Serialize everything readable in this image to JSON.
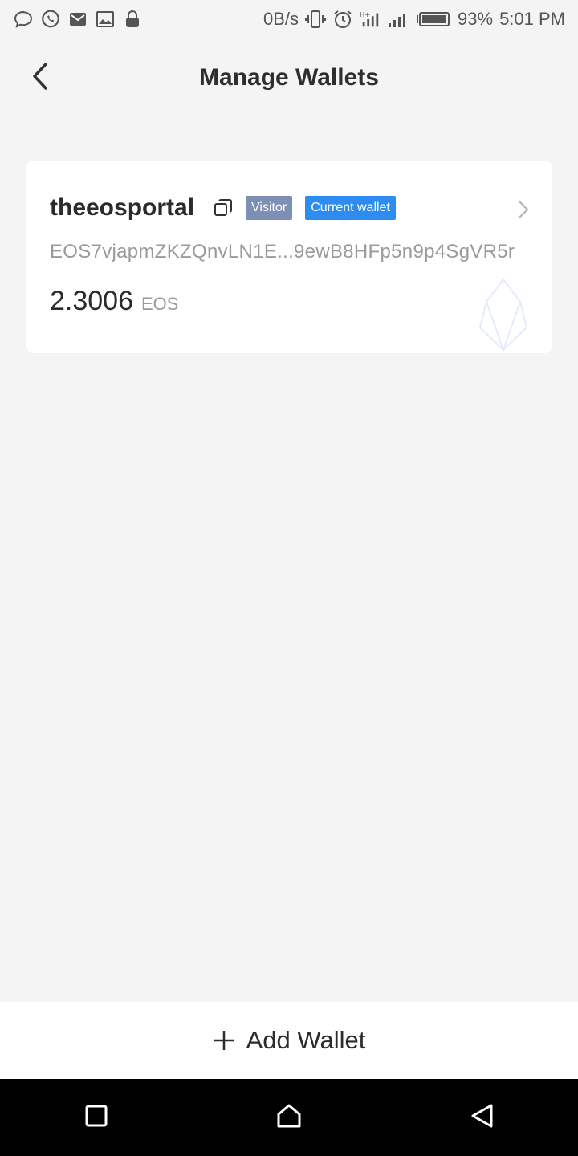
{
  "status_bar": {
    "left_icons": [
      "message-bubble-icon",
      "whatsapp-icon",
      "gmail-icon",
      "gallery-icon",
      "lock-icon"
    ],
    "net_speed": "0B/s",
    "right_icons": [
      "vibrate-icon",
      "alarm-icon",
      "signal-h-icon",
      "signal-icon",
      "battery-icon"
    ],
    "battery": "93%",
    "time": "5:01 PM"
  },
  "header": {
    "title": "Manage Wallets",
    "back_icon": "chevron-left-icon"
  },
  "wallet": {
    "name": "theeosportal",
    "badges": [
      "Visitor",
      "Current wallet"
    ],
    "address": "EOS7vjapmZKZQnvLN1E...9ewB8HFp5n9p4SgVR5r",
    "balance": "2.3006",
    "unit": "EOS",
    "colors": {
      "visitor_badge": "#7d8fb5",
      "current_badge": "#2d8cf0"
    }
  },
  "footer": {
    "add_wallet_label": "Add Wallet"
  },
  "nav": [
    "recents-square-icon",
    "home-icon",
    "back-triangle-icon"
  ]
}
